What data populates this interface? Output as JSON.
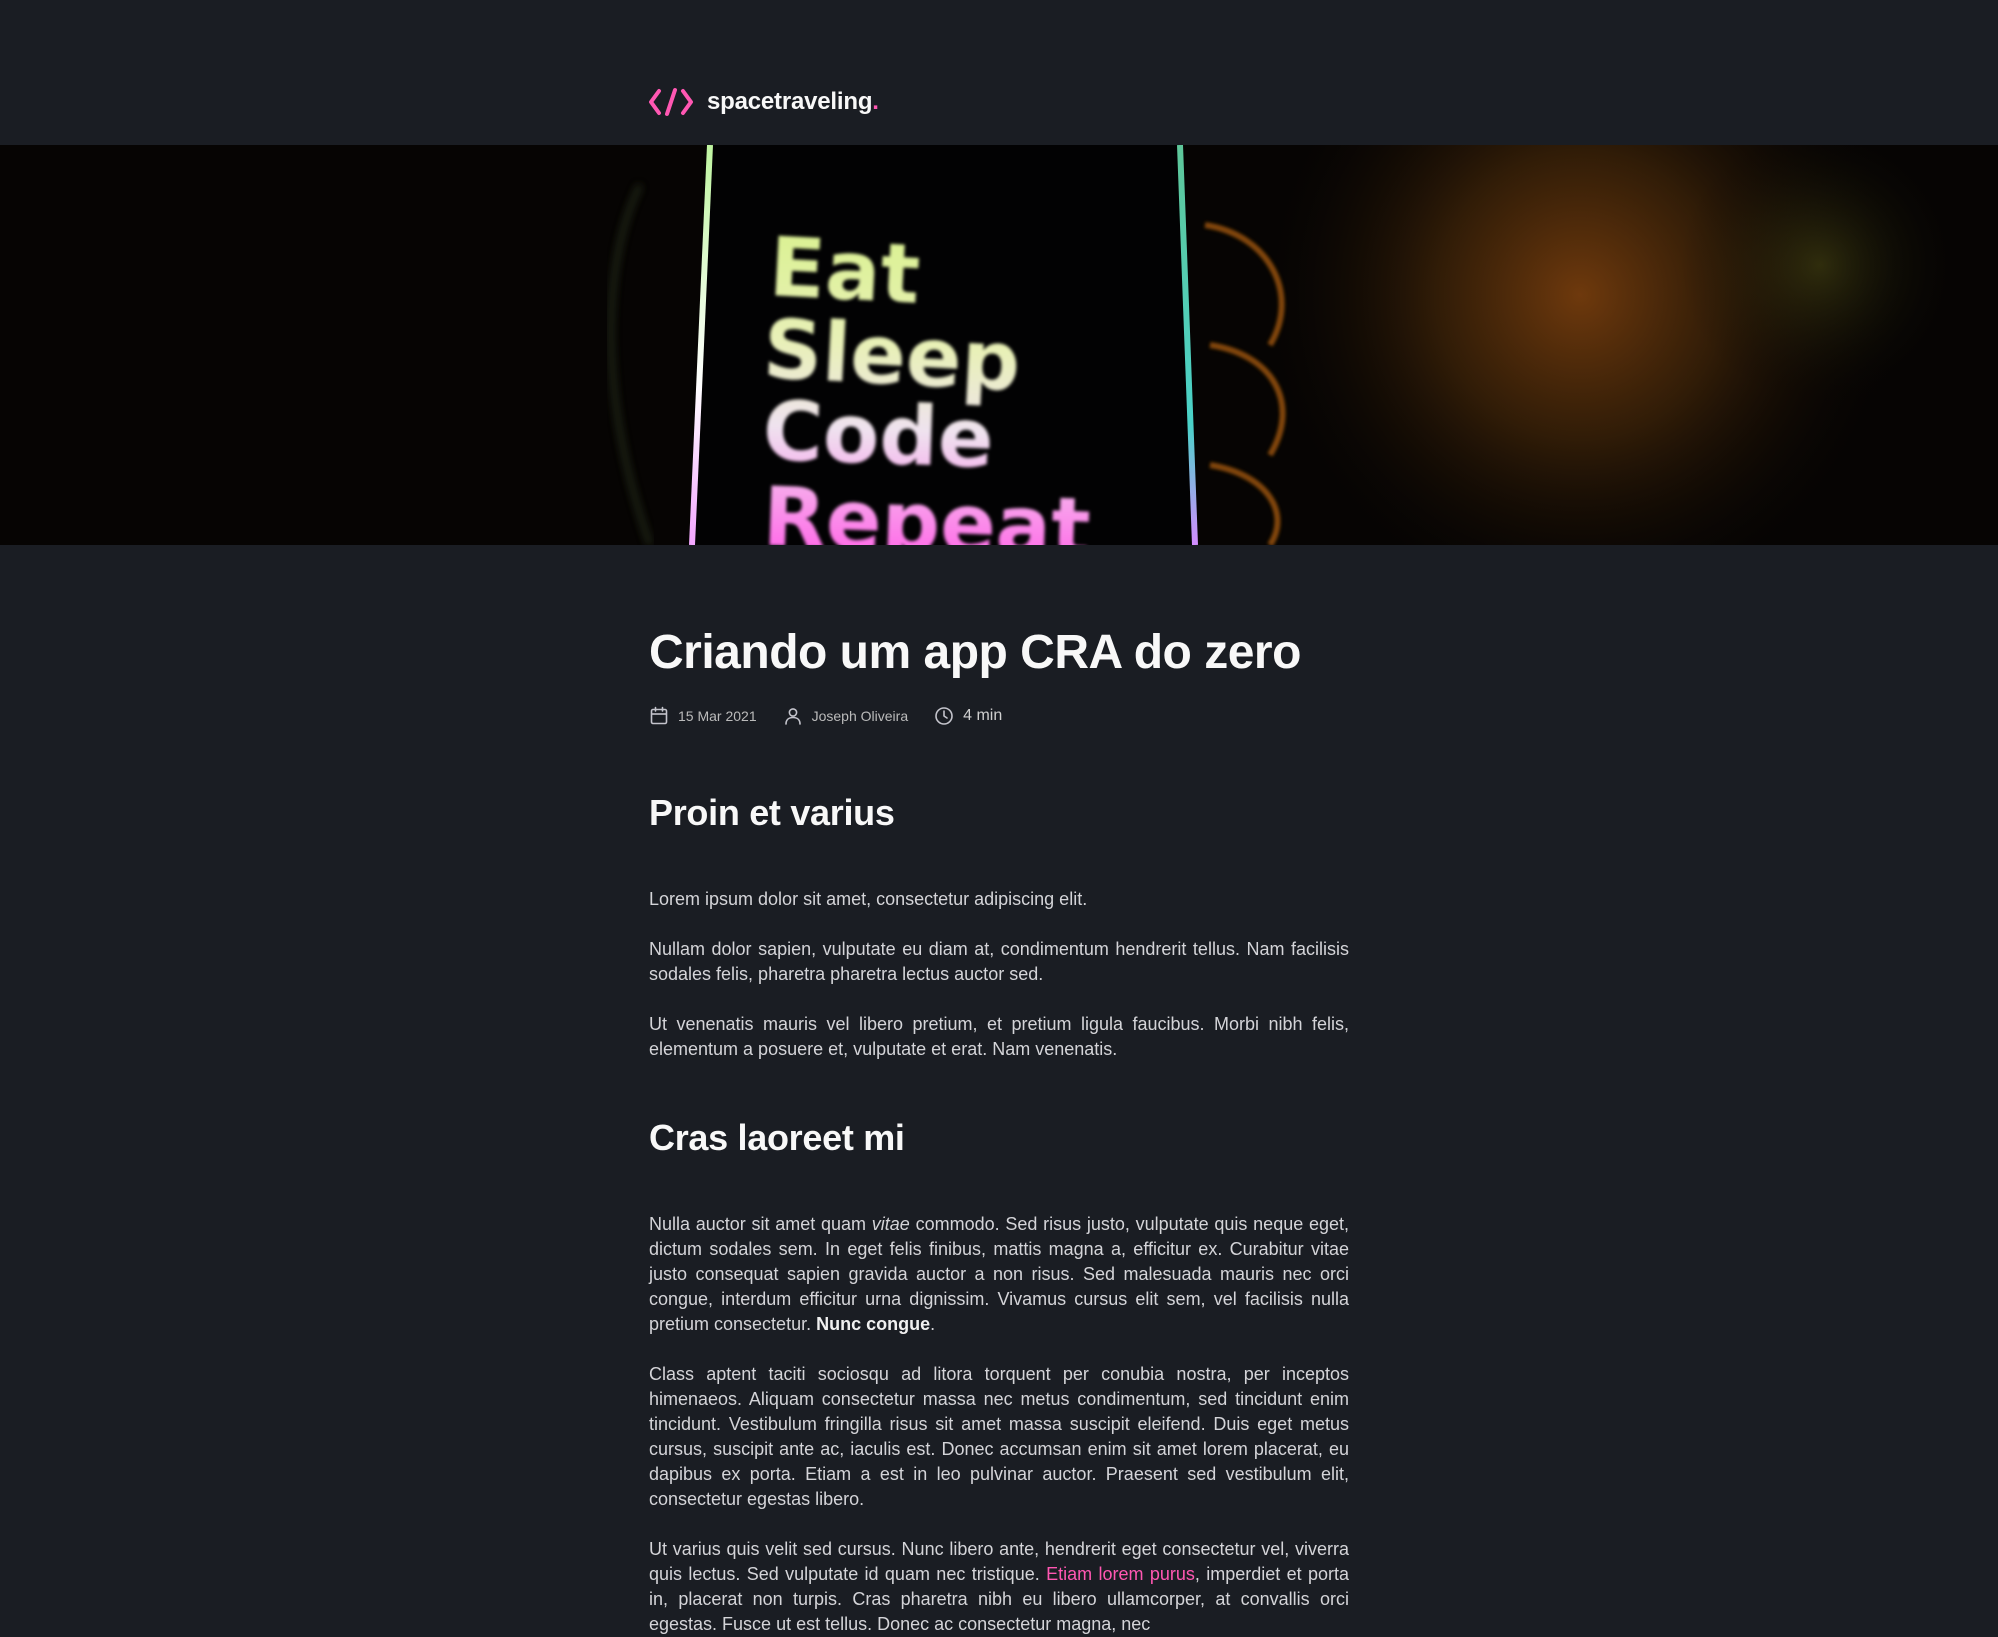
{
  "header": {
    "logo_icon": "code-brackets-icon",
    "brand_name": "spacetraveling",
    "brand_dot": ".",
    "accent_color": "#ff57b2"
  },
  "banner": {
    "words": [
      "Eat",
      "Sleep",
      "Code",
      "Repeat"
    ]
  },
  "post": {
    "title": "Criando um app CRA do zero",
    "date": "15 Mar 2021",
    "author": "Joseph Oliveira",
    "reading_time": "4 min",
    "icons": [
      "calendar-icon",
      "user-icon",
      "clock-icon"
    ]
  },
  "sections": [
    {
      "heading": "Proin et varius",
      "paragraphs": [
        "Lorem ipsum dolor sit amet, consectetur adipiscing elit.",
        "Nullam dolor sapien, vulputate eu diam at, condimentum hendrerit tellus. Nam facilisis sodales felis, pharetra pharetra lectus auctor sed.",
        "Ut venenatis mauris vel libero pretium, et pretium ligula faucibus. Morbi nibh felis, elementum a posuere et, vulputate et erat. Nam venenatis."
      ]
    },
    {
      "heading": "Cras laoreet mi",
      "p1": {
        "a": "Nulla auctor sit amet quam ",
        "b": "vitae",
        "c": " commodo. Sed risus justo, vulputate quis neque eget, dictum sodales sem. In eget felis finibus, mattis magna a, efficitur ex. Curabitur vitae justo consequat sapien gravida auctor a non risus. Sed malesuada mauris nec orci congue, interdum efficitur urna dignissim. Vivamus cursus elit sem, vel facilisis nulla pretium consectetur. ",
        "d": "Nunc congue",
        "e": "."
      },
      "p2": "Class aptent taciti sociosqu ad litora torquent per conubia nostra, per inceptos himenaeos. Aliquam consectetur massa nec metus condimentum, sed tincidunt enim tincidunt. Vestibulum fringilla risus sit amet massa suscipit eleifend. Duis eget metus cursus, suscipit ante ac, iaculis est. Donec accumsan enim sit amet lorem placerat, eu dapibus ex porta. Etiam a est in leo pulvinar auctor. Praesent sed vestibulum elit, consectetur egestas libero.",
      "p3": {
        "a": "Ut varius quis velit sed cursus. Nunc libero ante, hendrerit eget consectetur vel, viverra quis lectus. Sed vulputate id quam nec tristique. ",
        "link": "Etiam lorem purus",
        "c": ", imperdiet et porta in, placerat non turpis. Cras pharetra nibh eu libero ullamcorper, at convallis orci egestas. Fusce ut est tellus. Donec ac consectetur magna, nec"
      }
    }
  ]
}
